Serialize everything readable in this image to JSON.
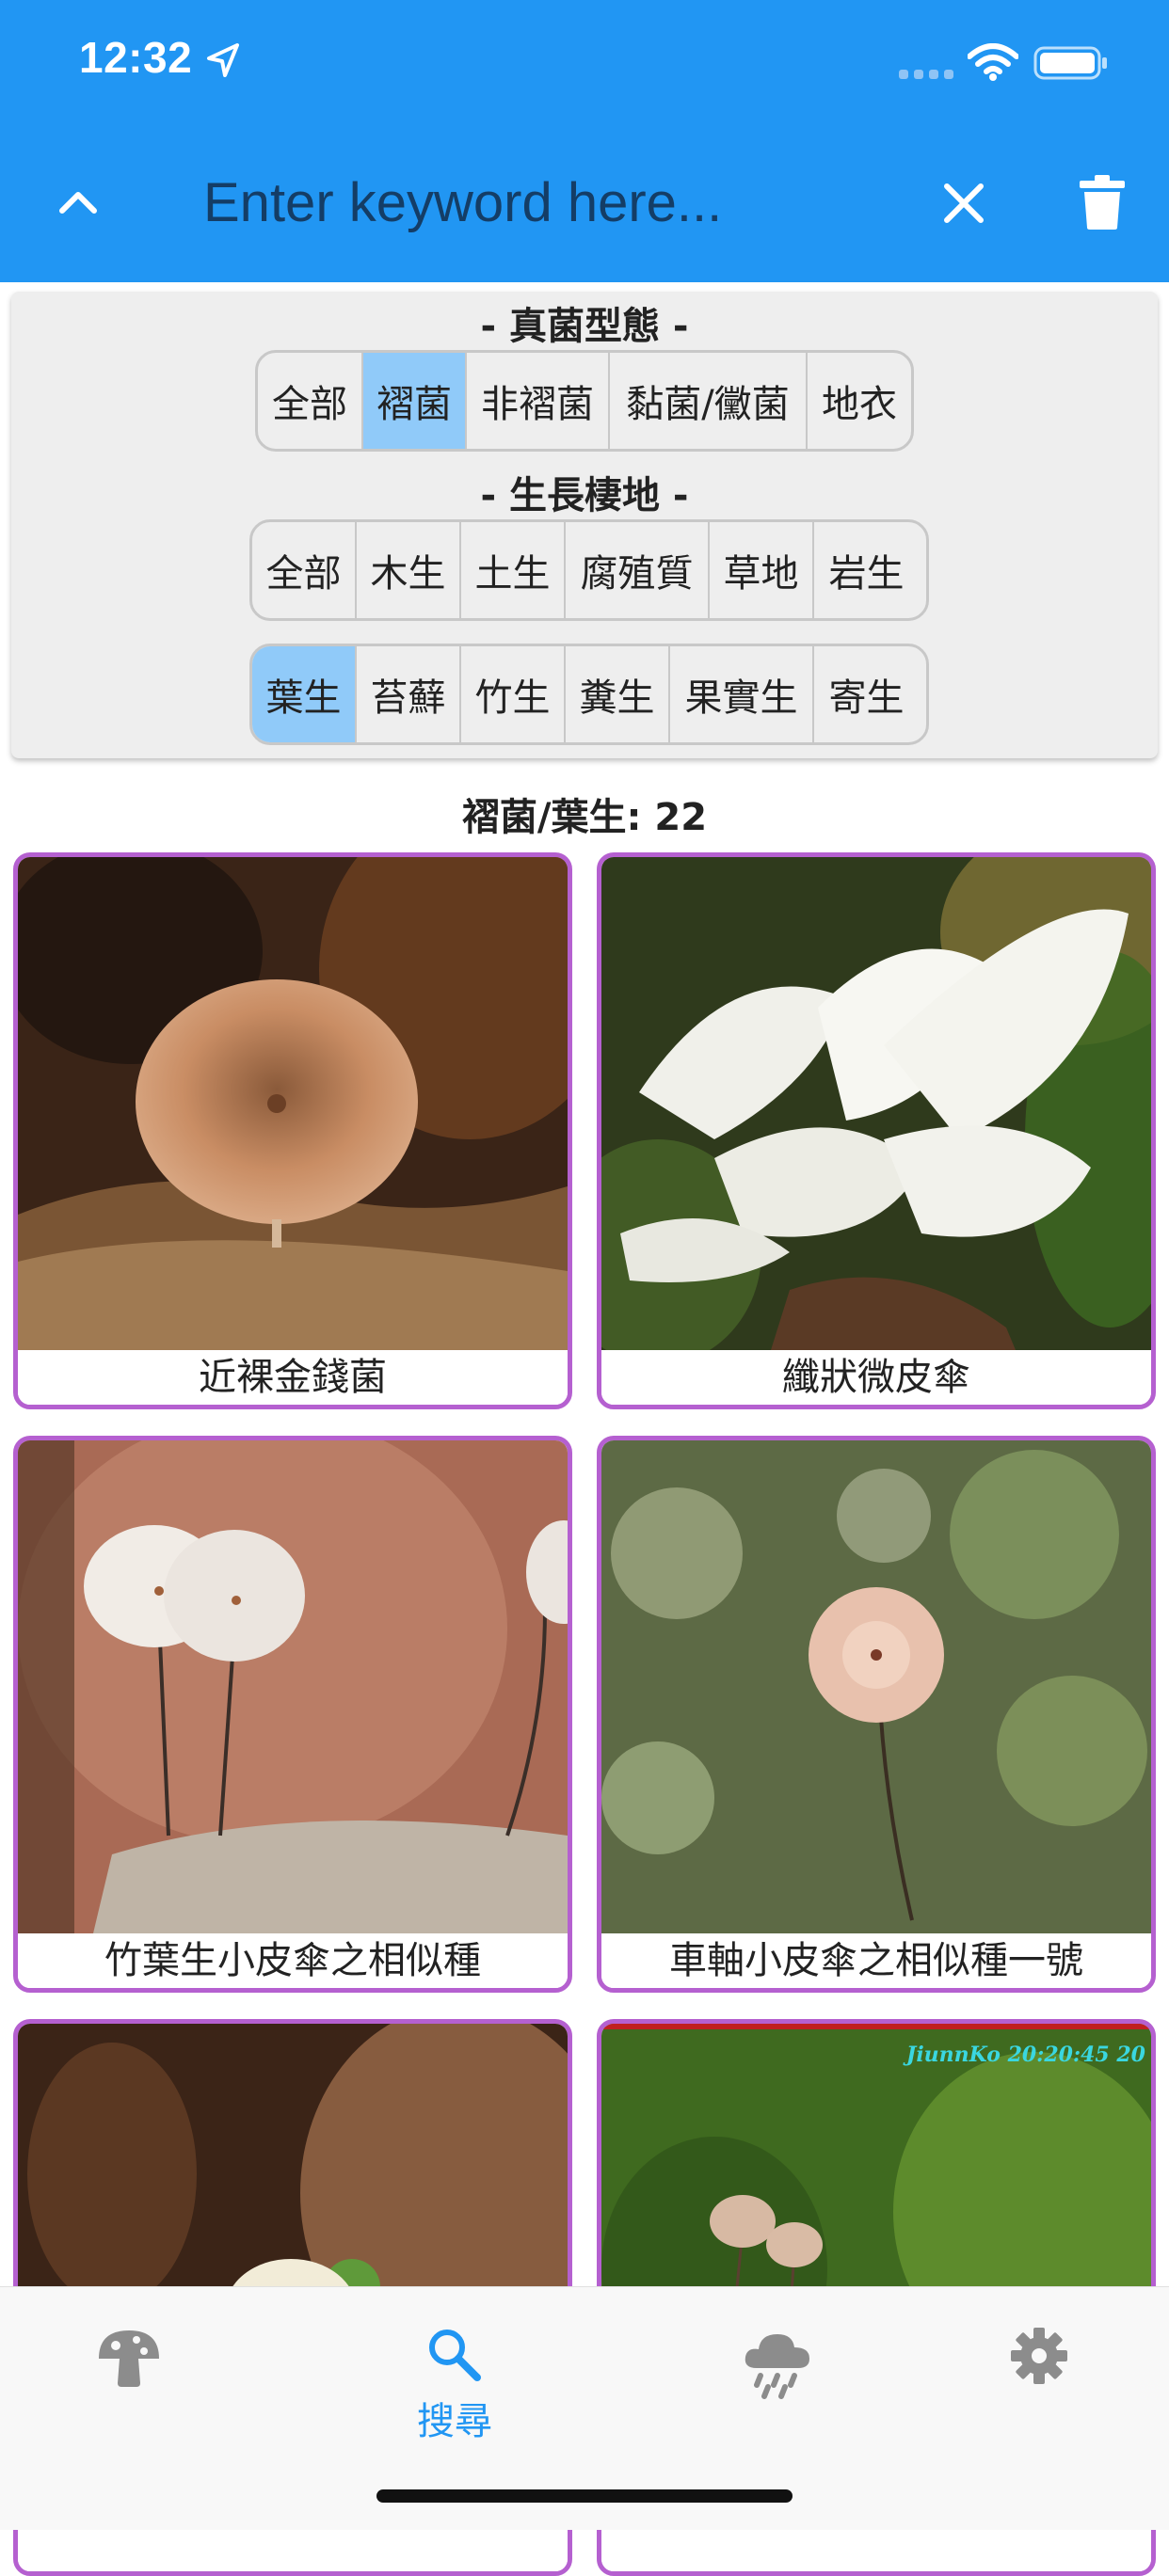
{
  "status_bar": {
    "time": "12:32"
  },
  "header": {
    "search_placeholder": "Enter keyword here..."
  },
  "filters": {
    "shape_title": "- 真菌型態 -",
    "shape_options": [
      "全部",
      "褶菌",
      "非褶菌",
      "黏菌/黴菌",
      "地衣"
    ],
    "shape_selected": "褶菌",
    "habitat_title": "- 生長棲地 -",
    "habitat_row1": [
      "全部",
      "木生",
      "土生",
      "腐殖質",
      "草地",
      "岩生"
    ],
    "habitat_row2": [
      "葉生",
      "苔蘚",
      "竹生",
      "糞生",
      "果實生",
      "寄生"
    ],
    "habitat_selected": "葉生"
  },
  "result_count_label": "褶菌/葉生: 22",
  "results": [
    {
      "name": "近裸金錢菌"
    },
    {
      "name": "纖狀微皮傘"
    },
    {
      "name": "竹葉生小皮傘之相似種"
    },
    {
      "name": "車軸小皮傘之相似種一號"
    },
    {
      "name": ""
    },
    {
      "name": ""
    }
  ],
  "photo_watermark": "JiunnKo 20:20:45 20",
  "tabbar": {
    "items": [
      {
        "icon": "mushroom-icon",
        "label": ""
      },
      {
        "icon": "search-icon",
        "label": "搜尋",
        "active": true
      },
      {
        "icon": "rain-cloud-icon",
        "label": ""
      },
      {
        "icon": "gear-icon",
        "label": ""
      }
    ]
  },
  "colors": {
    "primary": "#2196f3",
    "selected": "#90caf9",
    "card_border": "#b560d0"
  }
}
